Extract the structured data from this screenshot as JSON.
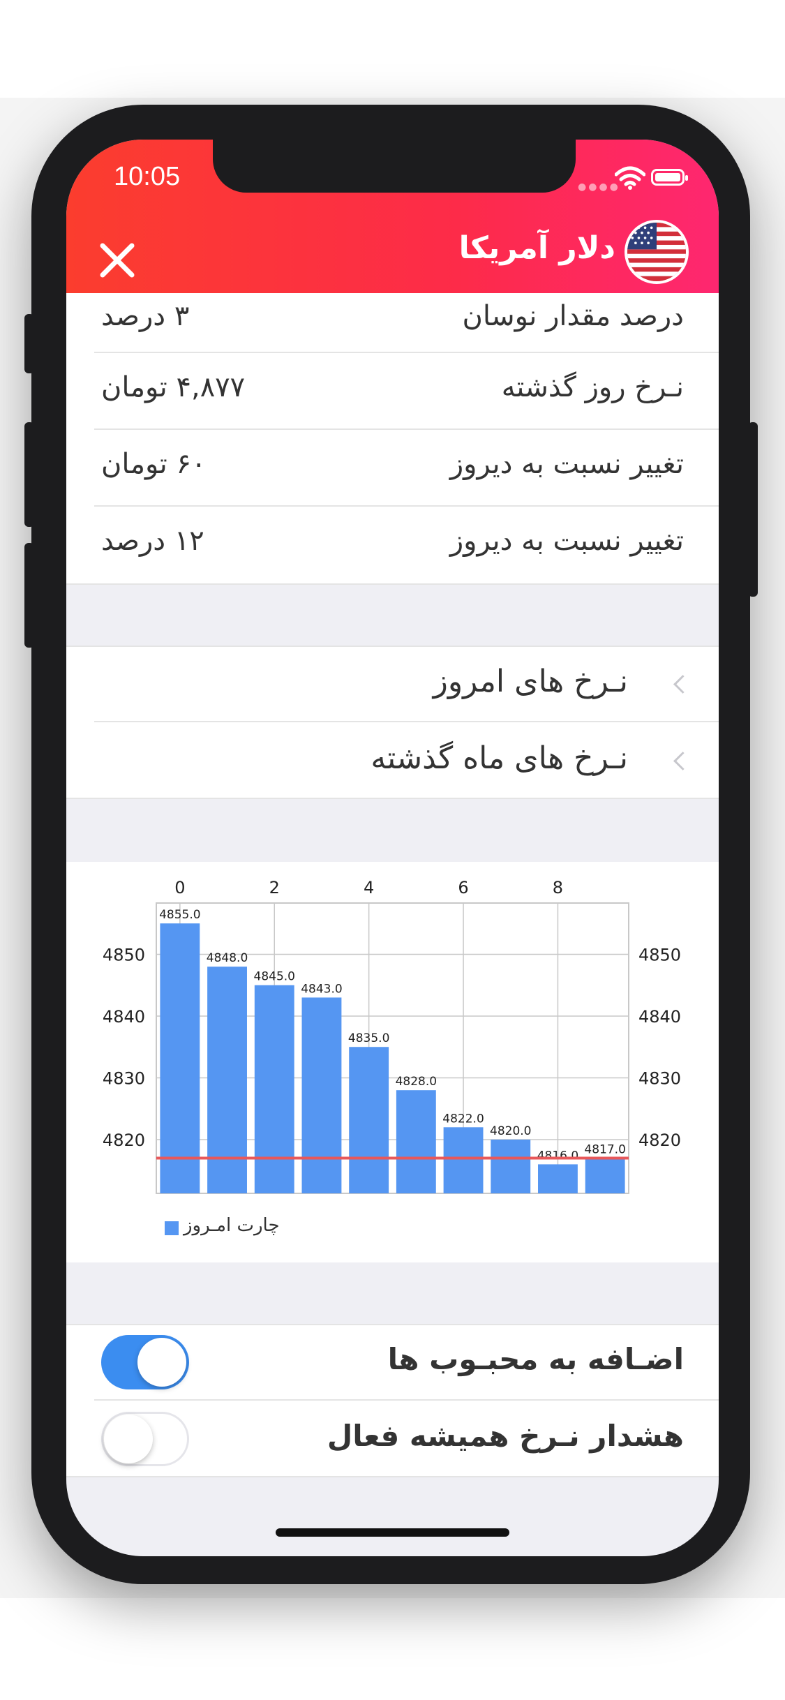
{
  "status_bar": {
    "time": "10:05"
  },
  "header": {
    "title": "دلار آمریکا",
    "icons": {
      "close": "close-icon",
      "flag": "us-flag-icon"
    }
  },
  "info_rows": [
    {
      "label": "درصد مقدار نوسان",
      "value": "۳ درصد"
    },
    {
      "label": "نـرخ روز گذشته",
      "value": "۴,۸۷۷ تومان"
    },
    {
      "label": "تغییر نسبت به دیروز",
      "value": "۶۰ تومان"
    },
    {
      "label": "تغییر نسبت به دیروز",
      "value": "۱۲ درصد"
    }
  ],
  "nav_rows": [
    {
      "label": "نـرخ های امروز"
    },
    {
      "label": "نـرخ های ماه گذشته"
    }
  ],
  "chart_data": {
    "type": "bar",
    "x": [
      0,
      1,
      2,
      3,
      4,
      5,
      6,
      7,
      8,
      9
    ],
    "x_tick_labels": [
      "0",
      "2",
      "4",
      "6",
      "8"
    ],
    "values": [
      4855.0,
      4848.0,
      4845.0,
      4843.0,
      4835.0,
      4828.0,
      4822.0,
      4820.0,
      4816.0,
      4817.0
    ],
    "value_labels": [
      "4855.0",
      "4848.0",
      "4845.0",
      "4843.0",
      "4835.0",
      "4828.0",
      "4822.0",
      "4820.0",
      "4816.0",
      "4817.0"
    ],
    "y_tick_labels": [
      "4850",
      "4840",
      "4830",
      "4820"
    ],
    "ylim": [
      4811.3,
      4858.3
    ],
    "limit_line": 4817,
    "legend": "چارت امـروز",
    "legend_position": "bottom-left",
    "grid": true,
    "colors": {
      "bar": "#5596f2",
      "limit_line": "#e8585a",
      "grid": "#c8c8c8"
    }
  },
  "toggles": [
    {
      "label": "اضـافه به محبـوب ها",
      "on": true
    },
    {
      "label": "هشدار نـرخ همیشه فعال",
      "on": false
    }
  ],
  "colors": {
    "accent": "#3b8df0",
    "header_start": "#fb3d2e",
    "header_end": "#fe2770"
  }
}
